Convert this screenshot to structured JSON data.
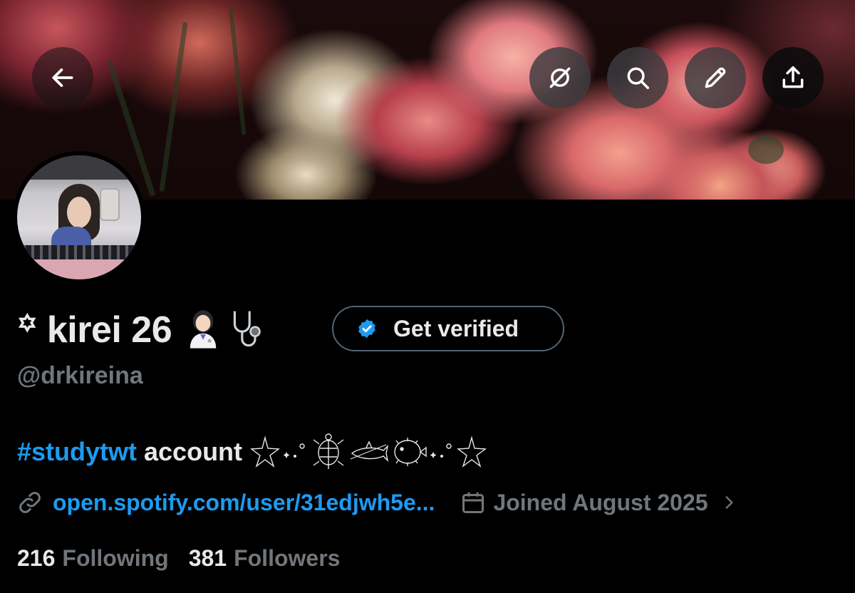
{
  "header": {
    "back_icon": "arrow-left-icon",
    "actions": [
      {
        "name": "grok-icon"
      },
      {
        "name": "search-icon"
      },
      {
        "name": "edit-icon"
      },
      {
        "name": "share-icon"
      }
    ]
  },
  "profile": {
    "display_name": "꙳ kirei 26",
    "name_emojis": [
      "woman-health-worker-emoji",
      "stethoscope-emoji"
    ],
    "get_verified_label": "Get verified",
    "handle": "@drkireina",
    "bio": {
      "hashtag": "#studytwt",
      "text": "account",
      "decorations": "⋆ ⋆.˚ 🐢 🦈 🐡⋆.˚ ⋆"
    },
    "website": "open.spotify.com/user/31edjwh5e...",
    "joined": "Joined August 2025",
    "following_count": "216",
    "following_label": "Following",
    "followers_count": "381",
    "followers_label": "Followers"
  },
  "colors": {
    "accent": "#1d9bf0",
    "text_primary": "#e7e9ea",
    "text_secondary": "#71767b",
    "background": "#000000"
  }
}
